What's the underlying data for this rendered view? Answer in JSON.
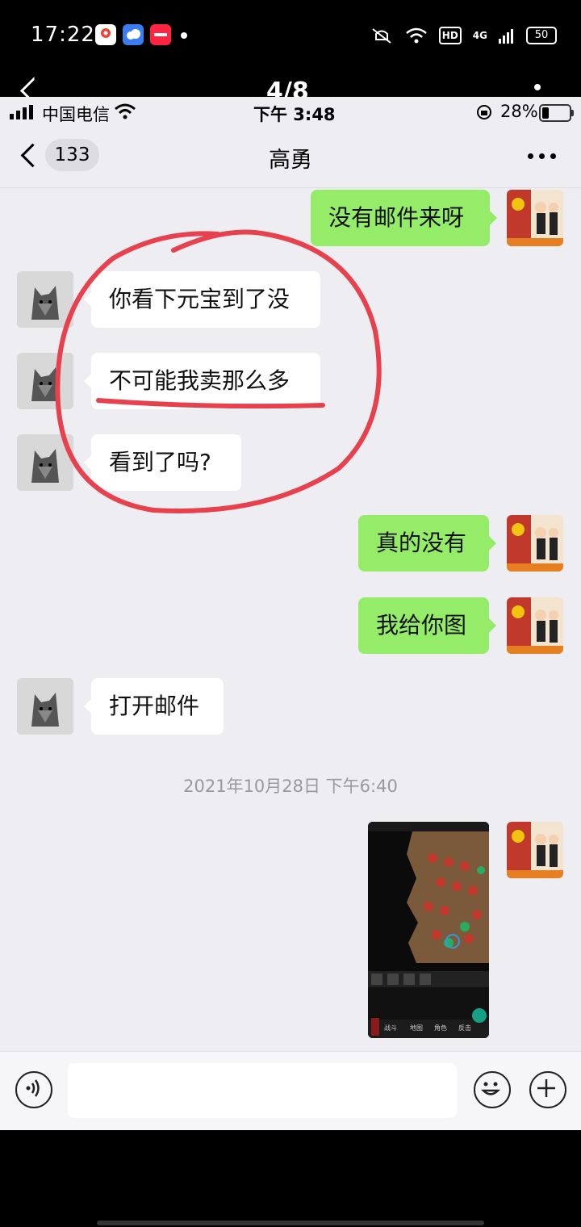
{
  "outer_status": {
    "time": "17:22",
    "battery": "50",
    "hd": "HD",
    "network": "4G"
  },
  "gallery": {
    "counter": "4/8"
  },
  "inner_status": {
    "carrier": "中国电信",
    "time": "下午 3:48",
    "battery": "28%"
  },
  "chat": {
    "unread_count": "133",
    "title": "高勇"
  },
  "messages": [
    {
      "side": "out",
      "text": "没有邮件来呀"
    },
    {
      "side": "in",
      "text": "你看下元宝到了没"
    },
    {
      "side": "in",
      "text": "不可能我卖那么多"
    },
    {
      "side": "in",
      "text": "看到了吗?"
    },
    {
      "side": "out",
      "text": "真的没有"
    },
    {
      "side": "out",
      "text": "我给你图"
    },
    {
      "side": "in",
      "text": "打开邮件"
    }
  ],
  "timestamp": "2021年10月28日 下午6:40",
  "game_image": {
    "tabs": [
      "战斗",
      "地图",
      "角色",
      "反击"
    ]
  },
  "colors": {
    "outgoing_bubble": "#95ec69",
    "annotation_red": "#e8414e",
    "chat_bg": "#eeeef2"
  }
}
